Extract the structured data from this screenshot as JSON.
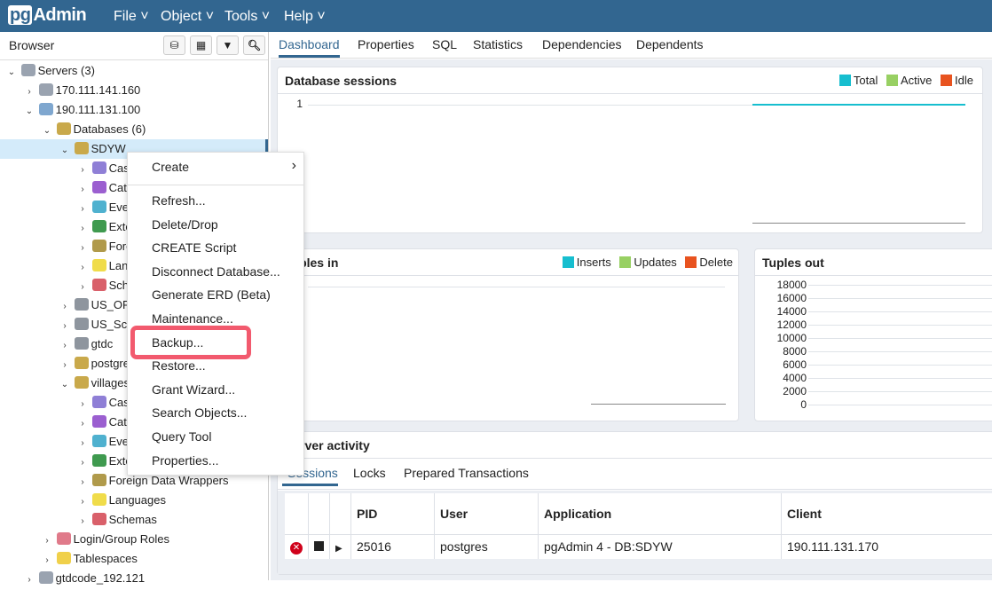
{
  "app": {
    "logo": "pgAdmin",
    "logo_pg": "pg",
    "logo_rest": "Admin"
  },
  "menus": [
    "File",
    "Object",
    "Tools",
    "Help"
  ],
  "browser": {
    "title": "Browser",
    "toolbar": [
      "query-tool-icon",
      "view-data-icon",
      "filter-icon",
      "search-icon"
    ]
  },
  "tree": [
    {
      "label": "Servers (3)",
      "depth": 0,
      "caret": "v",
      "icon": "servers-icon",
      "color": "#9aa3b0"
    },
    {
      "label": "170.111.141.160",
      "depth": 1,
      "caret": ">",
      "icon": "server-disconnected-icon",
      "color": "#9aa3b0"
    },
    {
      "label": "190.111.131.100",
      "depth": 1,
      "caret": "v",
      "icon": "postgres-elephant-icon",
      "color": "#7fa7cf"
    },
    {
      "label": "Databases (6)",
      "depth": 2,
      "caret": "v",
      "icon": "databases-icon",
      "color": "#c9a94b"
    },
    {
      "label": "SDYW",
      "depth": 3,
      "caret": "v",
      "icon": "database-icon",
      "color": "#c9a94b",
      "selected": true
    },
    {
      "label": "Casts",
      "depth": 4,
      "caret": ">",
      "icon": "casts-icon",
      "color": "#8f7fd6"
    },
    {
      "label": "Catalogs",
      "depth": 4,
      "caret": ">",
      "icon": "catalogs-icon",
      "color": "#9b5fd0"
    },
    {
      "label": "Event Triggers",
      "depth": 4,
      "caret": ">",
      "icon": "event-triggers-icon",
      "color": "#4fb1cf"
    },
    {
      "label": "Extensions",
      "depth": 4,
      "caret": ">",
      "icon": "extensions-icon",
      "color": "#3f9a4f"
    },
    {
      "label": "Foreign Data Wrappers",
      "depth": 4,
      "caret": ">",
      "icon": "foreign-data-wrappers-icon",
      "color": "#b09a4b"
    },
    {
      "label": "Languages",
      "depth": 4,
      "caret": ">",
      "icon": "languages-icon",
      "color": "#f0dc4a"
    },
    {
      "label": "Schemas",
      "depth": 4,
      "caret": ">",
      "icon": "schemas-icon",
      "color": "#d9606a"
    },
    {
      "label": "US_OP",
      "depth": 3,
      "caret": ">",
      "icon": "database-disconnected-icon",
      "color": "#8e959e"
    },
    {
      "label": "US_Sch",
      "depth": 3,
      "caret": ">",
      "icon": "database-disconnected-icon",
      "color": "#8e959e"
    },
    {
      "label": "gtdc",
      "depth": 3,
      "caret": ">",
      "icon": "database-disconnected-icon",
      "color": "#8e959e"
    },
    {
      "label": "postgres",
      "depth": 3,
      "caret": ">",
      "icon": "database-icon",
      "color": "#c9a94b"
    },
    {
      "label": "villages",
      "depth": 3,
      "caret": "v",
      "icon": "database-icon",
      "color": "#c9a94b"
    },
    {
      "label": "Casts",
      "depth": 4,
      "caret": ">",
      "icon": "casts-icon",
      "color": "#8f7fd6"
    },
    {
      "label": "Catalogs",
      "depth": 4,
      "caret": ">",
      "icon": "catalogs-icon",
      "color": "#9b5fd0"
    },
    {
      "label": "Event Triggers",
      "depth": 4,
      "caret": ">",
      "icon": "event-triggers-icon",
      "color": "#4fb1cf"
    },
    {
      "label": "Extensions",
      "depth": 4,
      "caret": ">",
      "icon": "extensions-icon",
      "color": "#3f9a4f"
    },
    {
      "label": "Foreign Data Wrappers",
      "depth": 4,
      "caret": ">",
      "icon": "foreign-data-wrappers-icon",
      "color": "#b09a4b"
    },
    {
      "label": "Languages",
      "depth": 4,
      "caret": ">",
      "icon": "languages-icon",
      "color": "#f0dc4a"
    },
    {
      "label": "Schemas",
      "depth": 4,
      "caret": ">",
      "icon": "schemas-icon",
      "color": "#d9606a"
    },
    {
      "label": "Login/Group Roles",
      "depth": 2,
      "caret": ">",
      "icon": "login-roles-icon",
      "color": "#e07a8a"
    },
    {
      "label": "Tablespaces",
      "depth": 2,
      "caret": ">",
      "icon": "tablespaces-icon",
      "color": "#f0d04a"
    },
    {
      "label": "gtdcode_192.121",
      "depth": 1,
      "caret": ">",
      "icon": "server-disconnected-icon",
      "color": "#9aa3b0"
    }
  ],
  "tabs": [
    "Dashboard",
    "Properties",
    "SQL",
    "Statistics",
    "Dependencies",
    "Dependents"
  ],
  "context_menu": {
    "items": [
      "Create",
      "Refresh...",
      "Delete/Drop",
      "CREATE Script",
      "Disconnect Database...",
      "Generate ERD (Beta)",
      "Maintenance...",
      "Backup...",
      "Restore...",
      "Grant Wizard...",
      "Search Objects...",
      "Query Tool",
      "Properties..."
    ],
    "highlighted": "Backup...",
    "highlight_color": "#f25a6e"
  },
  "sessions": {
    "title": "Database sessions",
    "legend": [
      {
        "name": "Total",
        "color": "#17becf"
      },
      {
        "name": "Active",
        "color": "#98d063"
      },
      {
        "name": "Idle",
        "color": "#e8531f"
      }
    ],
    "y_ticks": [
      "1"
    ]
  },
  "tuples_in": {
    "title": "Tuples in",
    "legend": [
      {
        "name": "Inserts",
        "color": "#17becf"
      },
      {
        "name": "Updates",
        "color": "#98d063"
      },
      {
        "name": "Delete",
        "color": "#e8531f"
      }
    ]
  },
  "tuples_out": {
    "title": "Tuples out",
    "y_ticks": [
      "18000",
      "16000",
      "14000",
      "12000",
      "10000",
      "8000",
      "6000",
      "4000",
      "2000",
      "0"
    ]
  },
  "activity": {
    "title": "Server activity",
    "tabs": [
      "Sessions",
      "Locks",
      "Prepared Transactions"
    ],
    "columns": [
      "PID",
      "User",
      "Application",
      "Client"
    ],
    "rows": [
      {
        "pid": "25016",
        "user": "postgres",
        "application": "pgAdmin 4 - DB:SDYW",
        "client": "190.111.131.170"
      }
    ]
  },
  "accent": "#326690"
}
